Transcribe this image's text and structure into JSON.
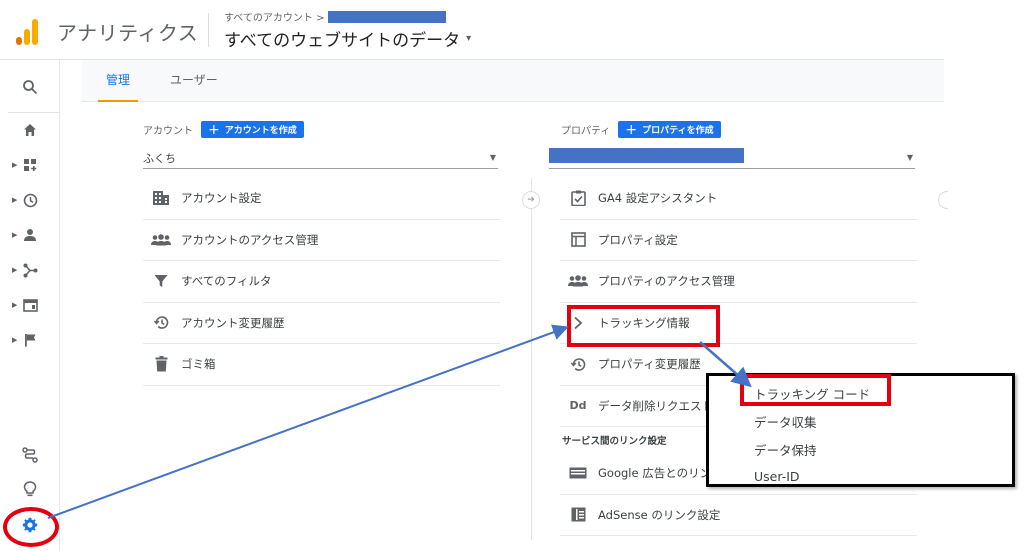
{
  "header": {
    "app_title": "アナリティクス",
    "breadcrumb": "すべてのアカウント >",
    "view_title": "すべてのウェブサイトのデータ",
    "view_caret": "▾"
  },
  "tabs": [
    {
      "label": "管理",
      "active": true
    },
    {
      "label": "ユーザー",
      "active": false
    }
  ],
  "account": {
    "heading": "アカウント",
    "create_button": "アカウントを作成",
    "selected": "ふくち",
    "items": [
      {
        "label": "アカウント設定",
        "icon": "building-icon"
      },
      {
        "label": "アカウントのアクセス管理",
        "icon": "people-icon"
      },
      {
        "label": "すべてのフィルタ",
        "icon": "filter-icon"
      },
      {
        "label": "アカウント変更履歴",
        "icon": "history-icon"
      },
      {
        "label": "ゴミ箱",
        "icon": "trash-icon"
      }
    ]
  },
  "property": {
    "heading": "プロパティ",
    "create_button": "プロパティを作成",
    "items": [
      {
        "label": "GA4 設定アシスタント",
        "icon": "clipboard-check-icon"
      },
      {
        "label": "プロパティ設定",
        "icon": "layout-icon"
      },
      {
        "label": "プロパティのアクセス管理",
        "icon": "people-icon"
      },
      {
        "label": "トラッキング情報",
        "icon": "chevron-right-icon"
      },
      {
        "label": "プロパティ変更履歴",
        "icon": "history-icon"
      },
      {
        "label": "データ削除リクエスト",
        "icon": "dd-icon",
        "icon_text": "Dd"
      }
    ],
    "section_header": "サービス間のリンク設定",
    "link_items": [
      {
        "label": "Google 広告とのリンク",
        "icon": "ads-icon"
      },
      {
        "label": "AdSense のリンク設定",
        "icon": "adsense-icon"
      }
    ]
  },
  "popup": {
    "items": [
      "トラッキング コード",
      "データ収集",
      "データ保持",
      "User-ID"
    ]
  },
  "colors": {
    "accent_blue": "#1a73e8",
    "tab_underline": "#f29900",
    "annotation_red": "#e3000f",
    "annotation_arrow": "#4472c4",
    "redaction": "#4472c4",
    "logo_orange": "#f9ab00",
    "logo_dark": "#e37400"
  }
}
